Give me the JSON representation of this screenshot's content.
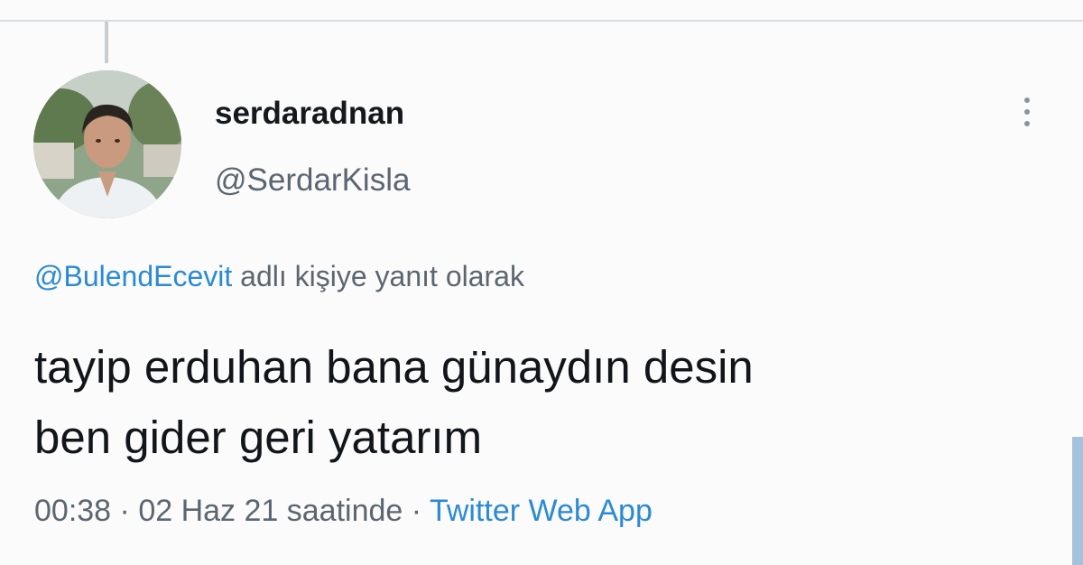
{
  "author": {
    "display_name": "serdaradnan",
    "handle": "@SerdarKisla",
    "avatar_icon": "profile-photo"
  },
  "reply": {
    "mention": "@BulendEcevit",
    "suffix": "adlı kişiye yanıt olarak"
  },
  "tweet": {
    "lines": [
      "tayip erduhan bana günaydın desin",
      "ben gider geri yatarım"
    ]
  },
  "meta": {
    "time": "00:38",
    "separator": "·",
    "date_text": "02 Haz 21 saatinde",
    "source": "Twitter Web App"
  },
  "menu": {
    "icon": "more-vertical-icon"
  },
  "colors": {
    "background": "#fbfbfb",
    "text_primary": "#121519",
    "text_secondary": "#5b6670",
    "link": "#2b8ad4"
  }
}
